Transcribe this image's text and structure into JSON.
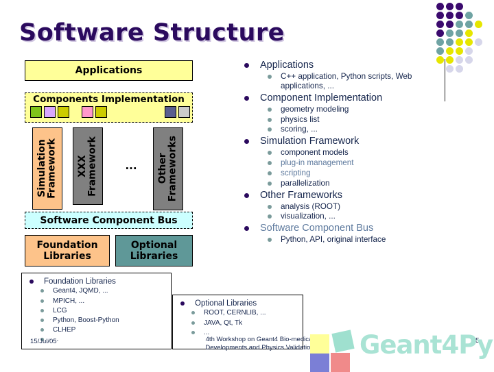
{
  "slide": {
    "title": "Software Structure",
    "date": "15/Jul/05",
    "footer": "4th Workshop on Geant4 Bio-medical Developments and Physics Validation",
    "page_number": "5"
  },
  "diagram": {
    "applications": "Applications",
    "components_implementation": "Components Implementation",
    "component_chips": [
      {
        "name": "chip-green",
        "color": "#7fc41a"
      },
      {
        "name": "chip-lavender",
        "color": "#d9a8ff"
      },
      {
        "name": "chip-olive-1",
        "color": "#cccc00"
      },
      {
        "name": "chip-pink",
        "color": "#ff99cc"
      },
      {
        "name": "chip-olive-2",
        "color": "#cccc00"
      },
      {
        "name": "chip-slate",
        "color": "#5a5f8f"
      },
      {
        "name": "chip-light-gray",
        "color": "#cccccc"
      }
    ],
    "simulation_framework": "Simulation\nFramework",
    "xxx_framework": "XXX\nFramework",
    "ellipsis": "...",
    "other_frameworks": "Other\nFrameworks",
    "software_component_bus": "Software Component Bus",
    "foundation_libraries": "Foundation Libraries",
    "optional_libraries": "Optional Libraries"
  },
  "outline": [
    {
      "label": "Applications",
      "tint": false,
      "children": [
        {
          "label": "C++ application, Python scripts, Web applications, ...",
          "tint": false
        }
      ]
    },
    {
      "label": "Component Implementation",
      "tint": false,
      "children": [
        {
          "label": "geometry modeling",
          "tint": false
        },
        {
          "label": "physics list",
          "tint": false
        },
        {
          "label": "scoring, ...",
          "tint": false
        }
      ]
    },
    {
      "label": "Simulation Framework",
      "tint": false,
      "children": [
        {
          "label": "component models",
          "tint": false
        },
        {
          "label": "plug-in management",
          "tint": true
        },
        {
          "label": "scripting",
          "tint": true
        },
        {
          "label": "parallelization",
          "tint": false
        }
      ]
    },
    {
      "label": "Other Frameworks",
      "tint": false,
      "children": [
        {
          "label": "analysis (ROOT)",
          "tint": false
        },
        {
          "label": "visualization, ...",
          "tint": false
        }
      ]
    },
    {
      "label": "Software Component Bus",
      "tint": true,
      "children": [
        {
          "label": "Python, API, original interface",
          "tint": false
        }
      ]
    }
  ],
  "notes": [
    {
      "name": "note-foundation",
      "title": "Foundation Libraries",
      "items": [
        "Geant4, JQMD, ...",
        "MPICH, ...",
        "LCG",
        "Python, Boost-Python",
        "CLHEP",
        "..."
      ]
    },
    {
      "name": "note-optional",
      "title": "Optional Libraries",
      "items": [
        "ROOT, CERNLIB, ...",
        "JAVA, Qt, Tk",
        "..."
      ]
    }
  ],
  "logo": {
    "wordmark": "Geant4Py",
    "squares": [
      {
        "name": "logo-square-yellow",
        "color": "#ffff99"
      },
      {
        "name": "logo-square-teal",
        "color": "#9fe0cf"
      },
      {
        "name": "logo-square-blue",
        "color": "#7b7fd6"
      },
      {
        "name": "logo-square-red",
        "color": "#f08a8a"
      }
    ]
  },
  "dot_matrix": {
    "colors": {
      "purple": "#3b0a6e",
      "teal": "#6fa3a3",
      "yellow": "#e6e600",
      "lavender": "#d6d6ea"
    },
    "grid": [
      [
        "purple",
        "purple",
        "purple",
        "none",
        "none"
      ],
      [
        "purple",
        "purple",
        "purple",
        "teal",
        "none"
      ],
      [
        "purple",
        "purple",
        "teal",
        "teal",
        "yellow"
      ],
      [
        "purple",
        "teal",
        "teal",
        "yellow",
        "none"
      ],
      [
        "teal",
        "teal",
        "yellow",
        "yellow",
        "lavender"
      ],
      [
        "teal",
        "yellow",
        "yellow",
        "lavender",
        "none"
      ],
      [
        "yellow",
        "yellow",
        "lavender",
        "lavender",
        "none"
      ],
      [
        "none",
        "lavender",
        "lavender",
        "none",
        "none"
      ]
    ]
  },
  "theme": {
    "title_color": "#2b0a5e",
    "body_text_color": "#15254c",
    "tint_text_color": "#5e7a9e",
    "bullet_l1_color": "#2b0a5e",
    "bullet_l2_color": "#7a9b9b",
    "panel_yellow": "#ffff99",
    "panel_cyan": "#ccffff",
    "panel_orange": "#fdc38a",
    "panel_teal": "#5f9898",
    "panel_gray": "#808080"
  }
}
